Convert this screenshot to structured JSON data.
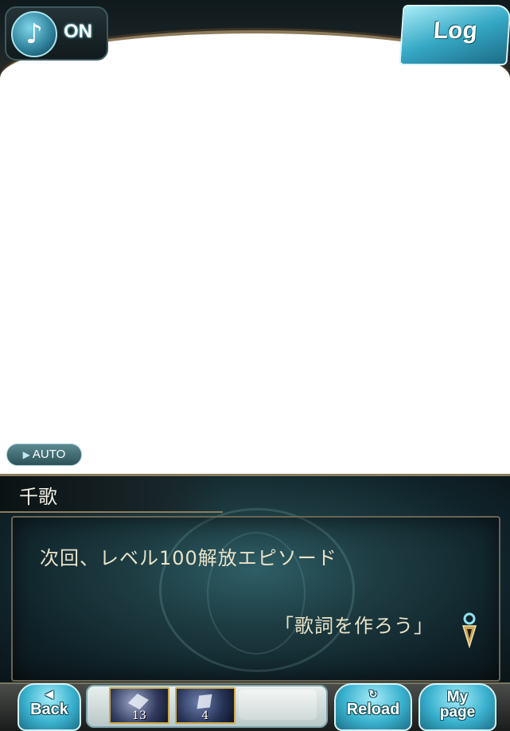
{
  "topbar": {
    "music": {
      "icon": "music-note-icon",
      "glyph": "♪",
      "state": "ON"
    },
    "log_label": "Log"
  },
  "auto": {
    "arrow": "▶",
    "label": "AUTO"
  },
  "dialogue": {
    "speaker": "千歌",
    "line1": "次回、レベル100解放エピソード",
    "line2": "「歌詞を作ろう」"
  },
  "bottombar": {
    "back": {
      "glyph": "◀",
      "label": "Back"
    },
    "reload": {
      "glyph": "↻",
      "label": "Reload"
    },
    "mypage": {
      "label_line1": "My",
      "label_line2": "page"
    },
    "items": [
      {
        "icon": "item-crystal-icon",
        "count": "13"
      },
      {
        "icon": "item-shard-icon",
        "count": "4"
      }
    ]
  },
  "colors": {
    "accent_cyan": "#3ab2cf",
    "dialogue_text": "#e9e3c8",
    "frame_gold": "#8a7c5e"
  }
}
